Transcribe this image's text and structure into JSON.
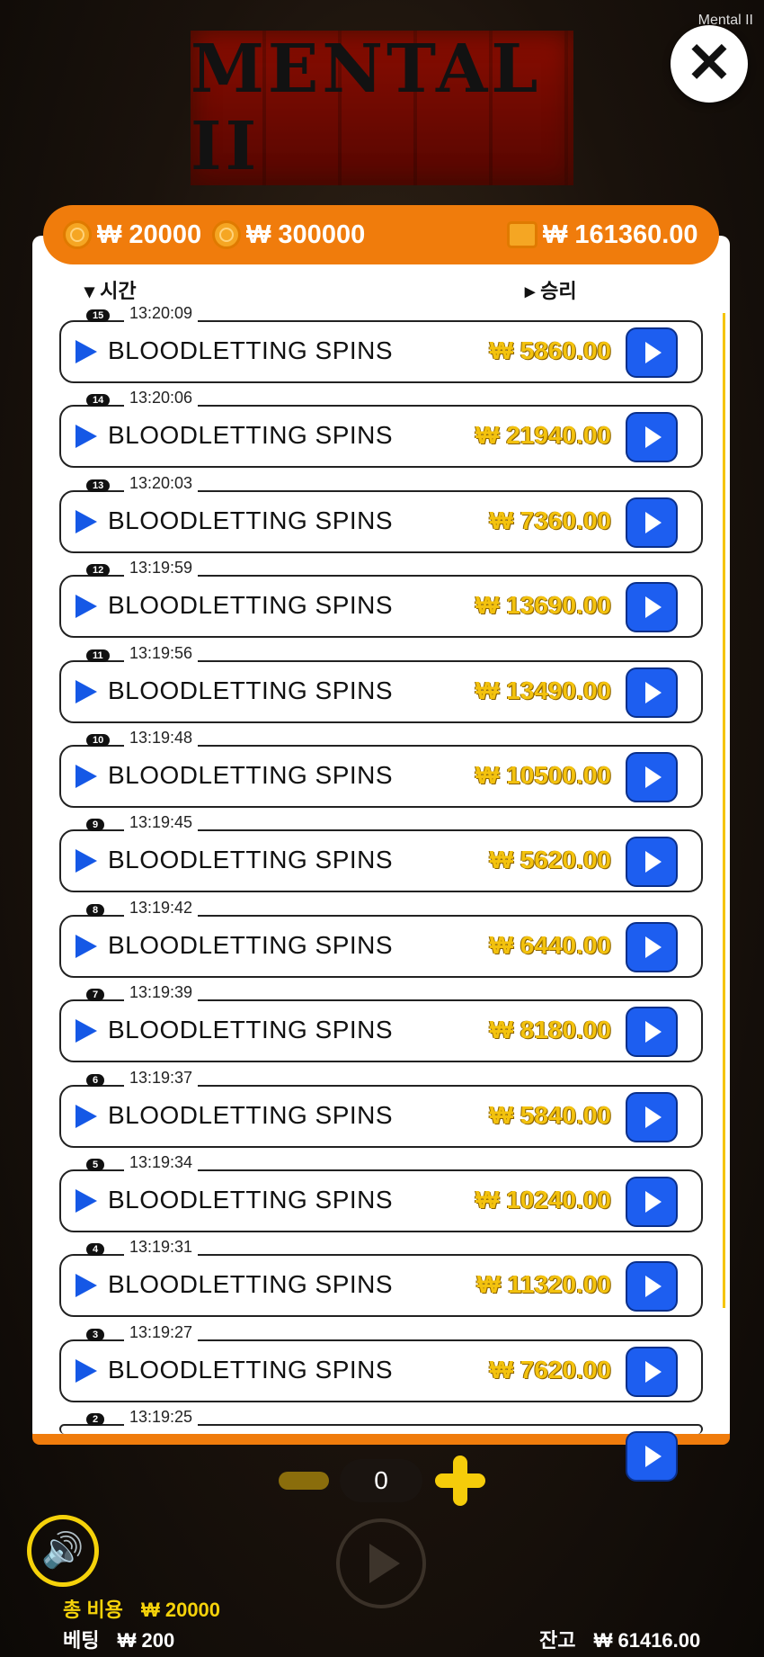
{
  "game": {
    "name": "Mental II",
    "logo_text": "MENTAL II"
  },
  "topbar": {
    "coin1": "₩ 20000",
    "coin2": "₩ 300000",
    "balance": "₩ 161360.00"
  },
  "headers": {
    "time": "시간",
    "win": "승리"
  },
  "rows": [
    {
      "num": "15",
      "time": "13:20:09",
      "label": "BLOODLETTING SPINS",
      "win": "₩ 5860.00"
    },
    {
      "num": "14",
      "time": "13:20:06",
      "label": "BLOODLETTING SPINS",
      "win": "₩ 21940.00"
    },
    {
      "num": "13",
      "time": "13:20:03",
      "label": "BLOODLETTING SPINS",
      "win": "₩ 7360.00"
    },
    {
      "num": "12",
      "time": "13:19:59",
      "label": "BLOODLETTING SPINS",
      "win": "₩ 13690.00"
    },
    {
      "num": "11",
      "time": "13:19:56",
      "label": "BLOODLETTING SPINS",
      "win": "₩ 13490.00"
    },
    {
      "num": "10",
      "time": "13:19:48",
      "label": "BLOODLETTING SPINS",
      "win": "₩ 10500.00"
    },
    {
      "num": "9",
      "time": "13:19:45",
      "label": "BLOODLETTING SPINS",
      "win": "₩ 5620.00"
    },
    {
      "num": "8",
      "time": "13:19:42",
      "label": "BLOODLETTING SPINS",
      "win": "₩ 6440.00"
    },
    {
      "num": "7",
      "time": "13:19:39",
      "label": "BLOODLETTING SPINS",
      "win": "₩ 8180.00"
    },
    {
      "num": "6",
      "time": "13:19:37",
      "label": "BLOODLETTING SPINS",
      "win": "₩ 5840.00"
    },
    {
      "num": "5",
      "time": "13:19:34",
      "label": "BLOODLETTING SPINS",
      "win": "₩ 10240.00"
    },
    {
      "num": "4",
      "time": "13:19:31",
      "label": "BLOODLETTING SPINS",
      "win": "₩ 11320.00"
    },
    {
      "num": "3",
      "time": "13:19:27",
      "label": "BLOODLETTING SPINS",
      "win": "₩ 7620.00"
    },
    {
      "num": "2",
      "time": "13:19:25",
      "label": "",
      "win": ""
    }
  ],
  "controls": {
    "stepper_value": "0"
  },
  "footer": {
    "total_cost_label": "총 비용",
    "total_cost_value": "₩ 20000",
    "bet_label": "베팅",
    "bet_value": "₩ 200",
    "balance_label": "잔고",
    "balance_value": "₩ 61416.00"
  },
  "colors": {
    "accent": "#f07c0c",
    "play_blue": "#1d5ef0",
    "win_gold": "#f3c20e"
  }
}
